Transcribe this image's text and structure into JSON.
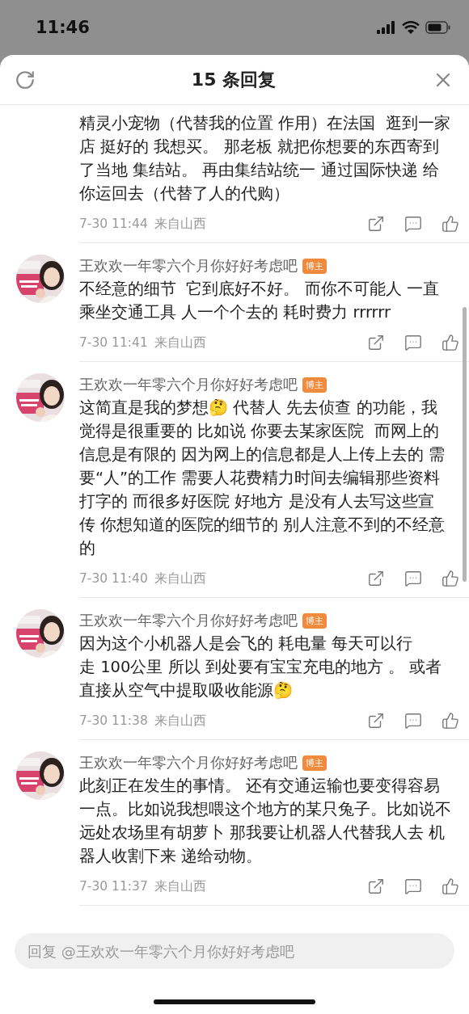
{
  "status_bar": {
    "time": "11:46"
  },
  "sheet": {
    "title": "15 条回复"
  },
  "comments": [
    {
      "text": "精灵小宠物（代替我的位置 作用）在法国  逛到一家店 挺好的 我想买。 那老板 就把你想要的东西寄到了当地 集结站。 再由集结站统一 通过国际快递 给你运回去（代替了人的代购）",
      "date": "7-30 11:44",
      "location": "来自山西"
    },
    {
      "author": "王欢欢一年零六个月你好好考虑吧",
      "badge": "博主",
      "text": "不经意的细节  它到底好不好。 而你不可能人 一直乘坐交通工具 人一个个去的 耗时费力 rrrrrr",
      "date": "7-30 11:41",
      "location": "来自山西"
    },
    {
      "author": "王欢欢一年零六个月你好好考虑吧",
      "badge": "博主",
      "text": "这简直是我的梦想🤔 代替人 先去侦查 的功能，我觉得是很重要的 比如说 你要去某家医院  而网上的信息是有限的 因为网上的信息都是人上传上去的 需要“人”的工作 需要人花费精力时间去编辑那些资料打字的 而很多好医院 好地方 是没有人去写这些宣传 你想知道的医院的细节的 别人注意不到的不经意的",
      "date": "7-30 11:40",
      "location": "来自山西"
    },
    {
      "author": "王欢欢一年零六个月你好好考虑吧",
      "badge": "博主",
      "text": "因为这个小机器人是会飞的 耗电量 每天可以行走 100公里 所以 到处要有宝宝充电的地方 。 或者直接从空气中提取吸收能源🤔",
      "date": "7-30 11:38",
      "location": "来自山西"
    },
    {
      "author": "王欢欢一年零六个月你好好考虑吧",
      "badge": "博主",
      "text": "此刻正在发生的事情。 还有交通运输也要变得容易一点。比如说我想喂这个地方的某只兔子。比如说不远处农场里有胡萝卜 那我要让机器人代替我人去 机器人收割下来 递给动物。",
      "date": "7-30 11:37",
      "location": "来自山西"
    }
  ],
  "reply_field": {
    "placeholder": "回复 @王欢欢一年零六个月你好好考虑吧"
  }
}
